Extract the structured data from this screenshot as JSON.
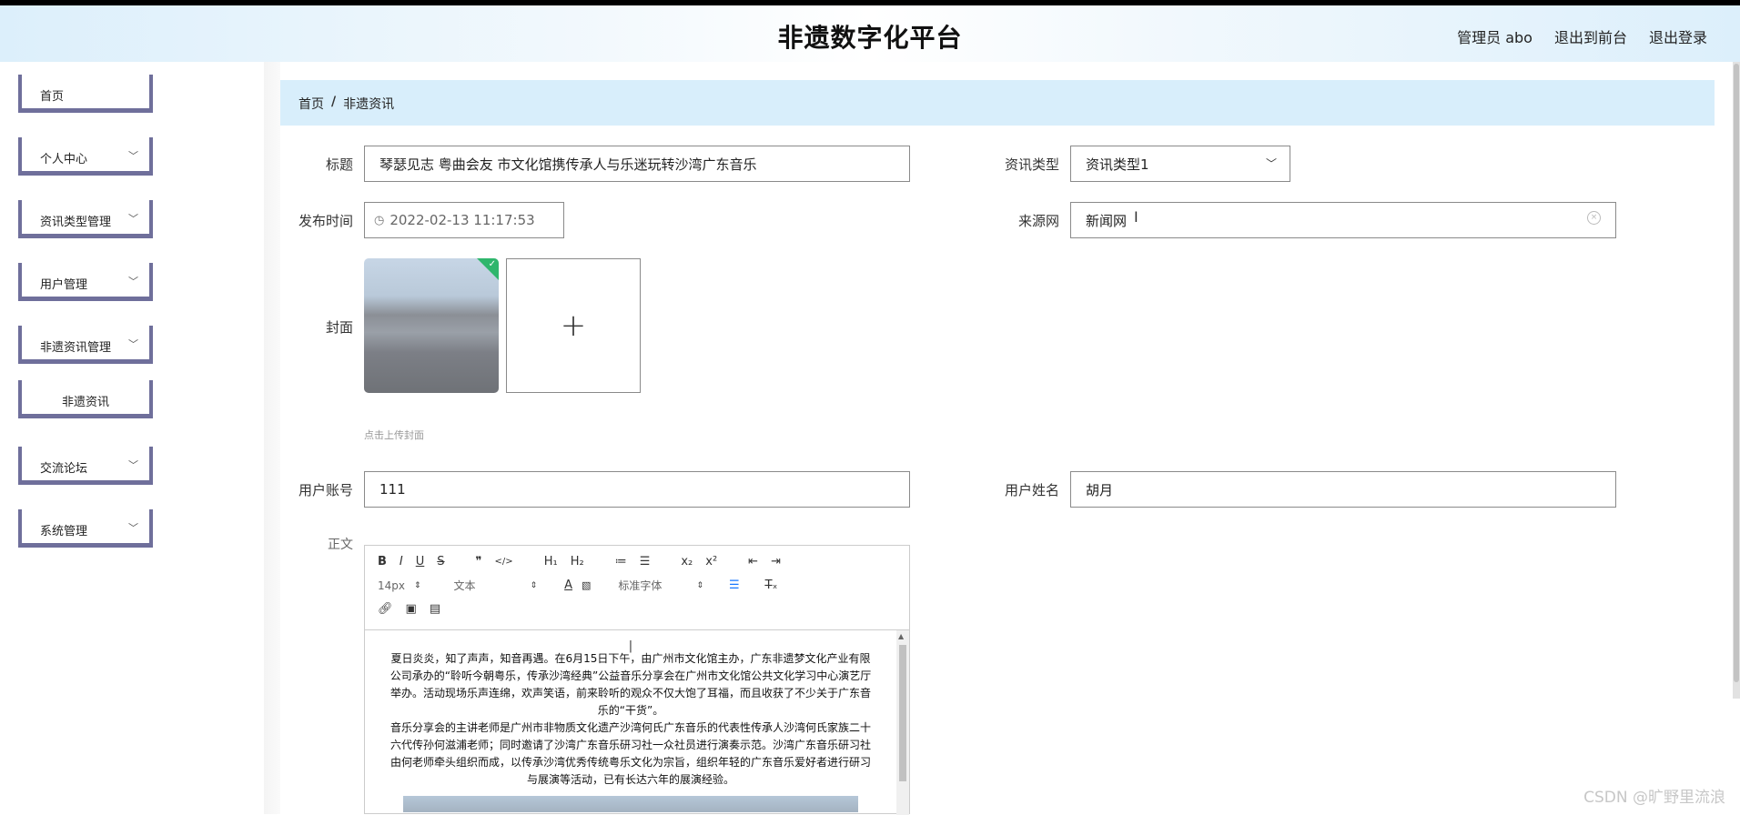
{
  "header": {
    "title": "非遗数字化平台",
    "user": "管理员 abo",
    "front_link": "退出到前台",
    "logout_link": "退出登录"
  },
  "sidebar": {
    "items": [
      {
        "label": "首页",
        "has_chevron": false
      },
      {
        "label": "个人中心",
        "has_chevron": true
      },
      {
        "label": "资讯类型管理",
        "has_chevron": true
      },
      {
        "label": "用户管理",
        "has_chevron": true
      },
      {
        "label": "非遗资讯管理",
        "has_chevron": true
      },
      {
        "label": "非遗资讯",
        "has_chevron": false,
        "sub": true
      },
      {
        "label": "交流论坛",
        "has_chevron": true
      },
      {
        "label": "系统管理",
        "has_chevron": true
      }
    ]
  },
  "breadcrumb": {
    "home": "首页",
    "sep": "/",
    "current": "非遗资讯"
  },
  "form": {
    "title_label": "标题",
    "title_value": "琴瑟见志 粤曲会友 市文化馆携传承人与乐迷玩转沙湾广东音乐",
    "type_label": "资讯类型",
    "type_value": "资讯类型1",
    "time_label": "发布时间",
    "time_value": "2022-02-13 11:17:53",
    "source_label": "来源网",
    "source_value": "新闻网",
    "cover_label": "封面",
    "cover_hint": "点击上传封面",
    "account_label": "用户账号",
    "account_value": "111",
    "name_label": "用户姓名",
    "name_value": "胡月",
    "body_label": "正文"
  },
  "editor": {
    "toolbar_row1": [
      "B",
      "I",
      "U",
      "S",
      "❞",
      "</>",
      "H₁",
      "H₂",
      "≔",
      "☰",
      "x₂",
      "x²",
      "⇤",
      "⇥"
    ],
    "font_size": "14px",
    "paragraph": "文本",
    "font_family": "标准字体",
    "paragraph1": "夏日炎炎，知了声声，知音再遇。在6月15日下午，由广州市文化馆主办，广东非遗梦文化产业有限公司承办的“聆听今朝粤乐，传承沙湾经典”公益音乐分享会在广州市文化馆公共文化学习中心演艺厅举办。活动现场乐声连绵，欢声笑语，前来聆听的观众不仅大饱了耳福，而且收获了不少关于广东音乐的“干货”。",
    "paragraph2": "音乐分享会的主讲老师是广州市非物质文化遗产沙湾何氏广东音乐的代表性传承人沙湾何氏家族二十六代传孙何滋浦老师；同时邀请了沙湾广东音乐研习社一众社员进行演奏示范。沙湾广东音乐研习社由何老师牵头组织而成，以传承沙湾优秀传统粤乐文化为宗旨，组织年轻的广东音乐爱好者进行研习与展演等活动，已有长达六年的展演经验。"
  },
  "watermark": "CSDN @旷野里流浪"
}
